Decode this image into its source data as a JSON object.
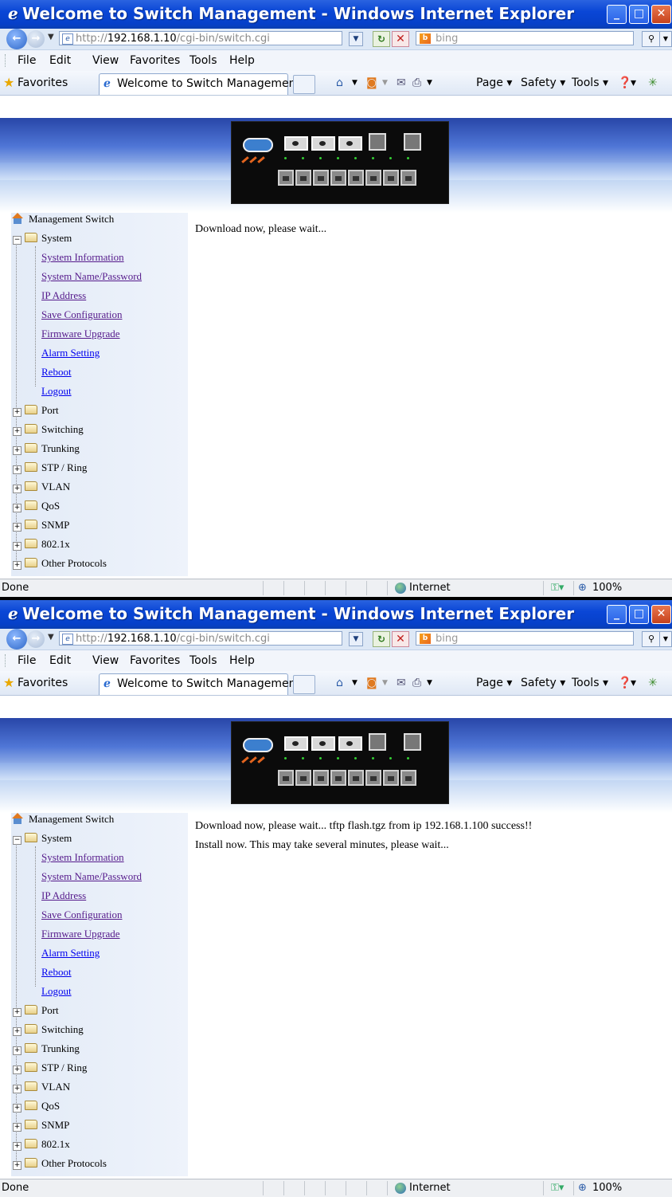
{
  "window_title": "Welcome to Switch Management - Windows Internet Explorer",
  "address": {
    "prefix": "http://",
    "host": "192.168.1.10",
    "path": "/cgi-bin/switch.cgi"
  },
  "search_placeholder": "bing",
  "menu": [
    "File",
    "Edit",
    "View",
    "Favorites",
    "Tools",
    "Help"
  ],
  "favorites_label": "Favorites",
  "tab_title": "Welcome to Switch Management",
  "command_bar": {
    "page": "Page ▾",
    "safety": "Safety ▾",
    "tools": "Tools ▾",
    "help": "▾"
  },
  "tree": {
    "root": "Management Switch",
    "system": "System",
    "system_links": [
      "System Information",
      "System Name/Password",
      "IP Address",
      "Save Configuration",
      "Firmware Upgrade",
      "Alarm Setting",
      "Reboot",
      "Logout"
    ],
    "folders": [
      "Port",
      "Switching",
      "Trunking",
      "STP / Ring",
      "VLAN",
      "QoS",
      "SNMP",
      "802.1x",
      "Other Protocols"
    ]
  },
  "screen1": {
    "message_lines": [
      "Download now, please wait..."
    ]
  },
  "screen2": {
    "message_lines": [
      "Download now, please wait... tftp flash.tgz from ip 192.168.1.100 success!!",
      "Install now. This may take several minutes, please wait..."
    ]
  },
  "status": {
    "text": "Done",
    "zone": "Internet",
    "zoom": "100%"
  },
  "colors": {
    "title_bar": "#0a46d6",
    "visited_link": "#551a8b",
    "link": "#0000ee"
  }
}
